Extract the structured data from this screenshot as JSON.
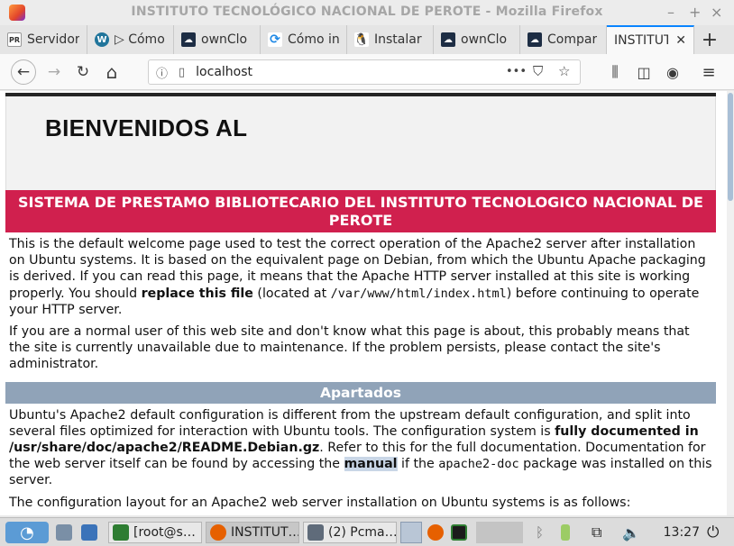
{
  "window": {
    "title": "INSTITUTO TECNOLÓGICO NACIONAL DE PEROTE - Mozilla Firefox",
    "minimize": "–",
    "maximize": "+",
    "close": "×"
  },
  "tabs": [
    {
      "label": "Servidor",
      "icon": "pr-icon",
      "color": "#ffffff"
    },
    {
      "label": "▷ Cómo",
      "icon": "wordpress-icon",
      "color": "#21759b"
    },
    {
      "label": "ownClo",
      "icon": "owncloud-icon",
      "color": "#1d2d44"
    },
    {
      "label": "Cómo in",
      "icon": "sync-icon",
      "color": "#1e88e5"
    },
    {
      "label": "Instalar",
      "icon": "linux-tux-icon",
      "color": "#222222"
    },
    {
      "label": "ownClo",
      "icon": "owncloud-icon",
      "color": "#1d2d44"
    },
    {
      "label": "Compar",
      "icon": "owncloud-icon",
      "color": "#1d2d44"
    },
    {
      "label": "INSTITUT",
      "icon": "none",
      "color": "#ffffff",
      "active": true
    }
  ],
  "newtab_label": "+",
  "nav": {
    "url": "localhost",
    "back": "←",
    "forward": "→",
    "reload": "↻",
    "home": "⌂",
    "page_actions": "•••",
    "library": "⫼",
    "sidebar": "◫",
    "account": "◉",
    "menu": "≡"
  },
  "page": {
    "heading": "BIENVENIDOS AL",
    "banner": "SISTEMA DE PRESTAMO BIBLIOTECARIO DEL INSTITUTO TECNOLOGICO NACIONAL DE PEROTE",
    "p1_a": "This is the default welcome page used to test the correct operation of the Apache2 server after installation on Ubuntu systems. It is based on the equivalent page on Debian, from which the Ubuntu Apache packaging is derived. If you can read this page, it means that the Apache HTTP server installed at this site is working properly. You should ",
    "p1_b": "replace this file",
    "p1_c": " (located at ",
    "p1_code": "/var/www/html/index.html",
    "p1_d": ") before continuing to operate your HTTP server.",
    "p2": "If you are a normal user of this web site and don't know what this page is about, this probably means that the site is currently unavailable due to maintenance. If the problem persists, please contact the site's administrator.",
    "section": "Apartados",
    "p3_a": "Ubuntu's Apache2 default configuration is different from the upstream default configuration, and split into several files optimized for interaction with Ubuntu tools. The configuration system is ",
    "p3_b": "fully documented in /usr/share/doc/apache2/README.Debian.gz",
    "p3_c": ". Refer to this for the full documentation. Documentation for the web server itself can be found by accessing the ",
    "p3_d": "manual",
    "p3_e": " if the ",
    "p3_code": "apache2-doc",
    "p3_f": " package was installed on this server.",
    "p4": "The configuration layout for an Apache2 web server installation on Ubuntu systems is as follows:"
  },
  "taskbar": {
    "items": [
      {
        "label": "[root@s…",
        "icon": "terminal-icon",
        "color": "#2e7d32"
      },
      {
        "label": "INSTITUT…",
        "icon": "firefox-icon",
        "color": "#e66000",
        "active": true
      },
      {
        "label": "(2) Pcma…",
        "icon": "folder-icon",
        "color": "#5f6b7a"
      }
    ],
    "clock": "13:27"
  }
}
